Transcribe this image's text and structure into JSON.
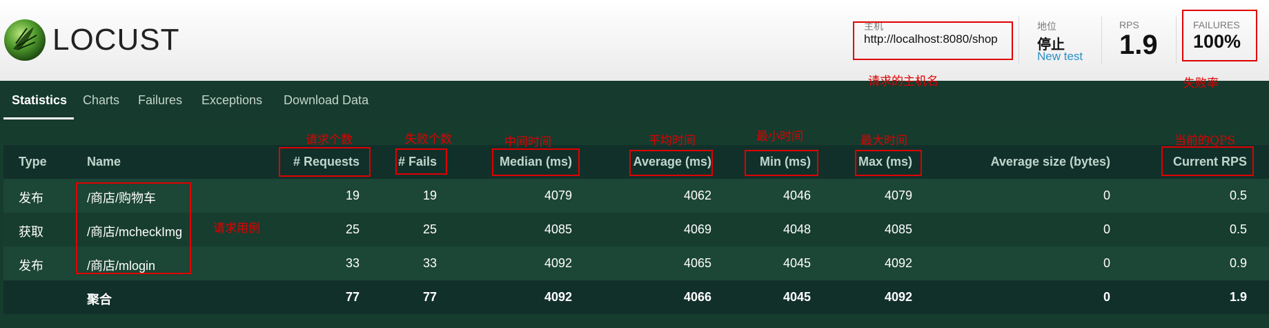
{
  "brand": {
    "name": "LOCUST"
  },
  "header": {
    "host_label": "主机",
    "host_value": "http://localhost:8080/shop",
    "status_label": "地位",
    "status_value": "停止",
    "new_test": "New test",
    "rps_label": "RPS",
    "rps_value": "1.9",
    "failures_label": "FAILURES",
    "failures_value": "100%"
  },
  "tabs": [
    "Statistics",
    "Charts",
    "Failures",
    "Exceptions",
    "Download Data"
  ],
  "table": {
    "headers": [
      "Type",
      "Name",
      "# Requests",
      "# Fails",
      "Median (ms)",
      "Average (ms)",
      "Min (ms)",
      "Max (ms)",
      "Average size (bytes)",
      "Current RPS"
    ],
    "rows": [
      [
        "发布",
        "/商店/购物车",
        "19",
        "19",
        "4079",
        "4062",
        "4046",
        "4079",
        "0",
        "0.5"
      ],
      [
        "获取",
        "/商店/mcheckImg",
        "25",
        "25",
        "4085",
        "4069",
        "4048",
        "4085",
        "0",
        "0.5"
      ],
      [
        "发布",
        "/商店/mlogin",
        "33",
        "33",
        "4092",
        "4065",
        "4045",
        "4092",
        "0",
        "0.9"
      ]
    ],
    "total": [
      "",
      "聚合",
      "77",
      "77",
      "4092",
      "4066",
      "4045",
      "4092",
      "0",
      "1.9"
    ]
  },
  "annotations": {
    "host": "请求的主机名",
    "failures": "失败率",
    "requests": "请求个数",
    "fails": "失败个数",
    "median": "中间时间",
    "average": "平均时间",
    "min": "最小时间",
    "max": "最大时间",
    "current_rps": "当前的QPS",
    "name": "请求用例"
  },
  "colors": {
    "accent": "#2a8fc8",
    "annotation": "#e00000",
    "table_header": "#12302a",
    "row_a": "#1c4636",
    "row_b": "#173d2f",
    "total_row": "#12302a"
  }
}
